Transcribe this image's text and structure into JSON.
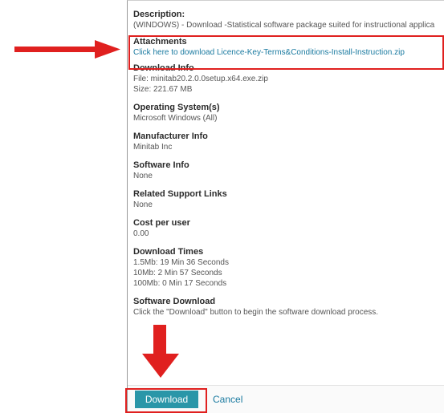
{
  "details": {
    "description_label": "Description:",
    "description_value": "(WINDOWS) - Download -Statistical software package suited for instructional applica",
    "attachments_label": "Attachments",
    "attachments_link": "Click here to download Licence-Key-Terms&Conditions-Install-Instruction.zip",
    "download_info_label": "Download Info",
    "download_file": "File: minitab20.2.0.0setup.x64.exe.zip",
    "download_size": "Size: 221.67 MB",
    "os_label": "Operating System(s)",
    "os_value": "Microsoft Windows (All)",
    "manufacturer_label": "Manufacturer Info",
    "manufacturer_value": "Minitab Inc",
    "software_info_label": "Software Info",
    "software_info_value": "None",
    "related_links_label": "Related Support Links",
    "related_links_value": "None",
    "cost_label": "Cost per user",
    "cost_value": "0.00",
    "download_times_label": "Download Times",
    "download_times": [
      "1.5Mb: 19 Min 36 Seconds",
      "10Mb: 2 Min 57 Seconds",
      "100Mb: 0 Min 17 Seconds"
    ],
    "software_download_label": "Software Download",
    "software_download_value": "Click the \"Download\" button to begin the software download process."
  },
  "footer": {
    "download_label": "Download",
    "cancel_label": "Cancel"
  },
  "colors": {
    "annotation": "#e0201f",
    "button": "#2a96a8",
    "link": "#1a7aa0"
  }
}
